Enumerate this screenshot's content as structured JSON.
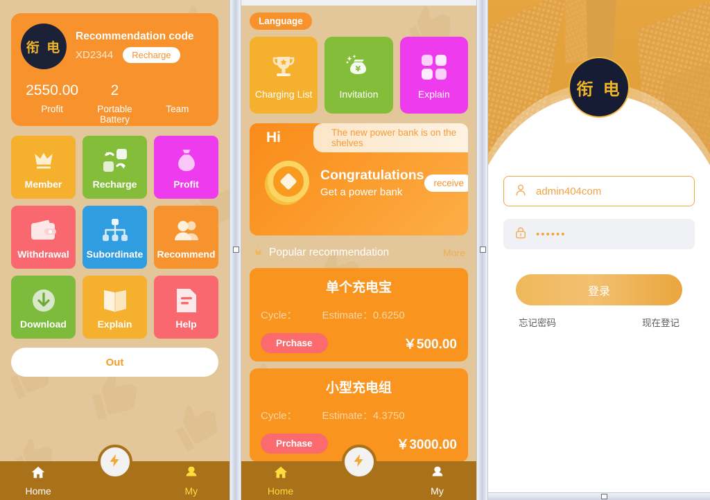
{
  "panel1": {
    "profile": {
      "logo_text": "衔 电",
      "title": "Recommendation code",
      "code": "XD2344",
      "recharge_label": "Recharge",
      "stats": [
        {
          "value": "2550.00",
          "label": "Profit"
        },
        {
          "value": "2",
          "label": "Portable Battery"
        },
        {
          "value": "",
          "label": "Team"
        }
      ]
    },
    "tiles": [
      {
        "label": "Member",
        "icon": "crown-icon",
        "bg": "#f5b02e"
      },
      {
        "label": "Recharge",
        "icon": "exchange-icon",
        "bg": "#84bd3a"
      },
      {
        "label": "Profit",
        "icon": "money-bag-icon",
        "bg": "#ee3bee"
      },
      {
        "label": "Withdrawal",
        "icon": "wallet-icon",
        "bg": "#f9686e"
      },
      {
        "label": "Subordinate",
        "icon": "hierarchy-icon",
        "bg": "#309de0"
      },
      {
        "label": "Recommend",
        "icon": "users-icon",
        "bg": "#f7932e"
      },
      {
        "label": "Download",
        "icon": "download-icon",
        "bg": "#7dbb3c"
      },
      {
        "label": "Explain",
        "icon": "book-icon",
        "bg": "#f5b02e"
      },
      {
        "label": "Help",
        "icon": "document-icon",
        "bg": "#f9686e"
      }
    ],
    "out_label": "Out",
    "tabbar": {
      "home_label": "Home",
      "my_label": "My",
      "active": "my",
      "fab_icon": "bolt-icon"
    }
  },
  "panel2": {
    "language_label": "Language",
    "quick_tiles": [
      {
        "label": "Charging List",
        "icon": "trophy-icon",
        "bg": "#f5b02e"
      },
      {
        "label": "Invitation",
        "icon": "money-bag-icon",
        "bg": "#84bd3a"
      },
      {
        "label": "Explain",
        "icon": "grid-apps-icon",
        "bg": "#ee3bee"
      }
    ],
    "promo": {
      "hi": "Hi",
      "ticker": "The new power bank is on the shelves",
      "title": "Congratulations",
      "subtitle": "Get a power bank",
      "receive_label": "receive",
      "coin_icon": "gold-coin-icon"
    },
    "section": {
      "flame_icon": "flame-icon",
      "title": "Popular recommendation",
      "more_label": "More"
    },
    "products": [
      {
        "name": "单个充电宝",
        "cycle_label": "Cycle：",
        "estimate_label": "Estimate：0.6250",
        "buy_label": "Prchase",
        "price": "￥500.00"
      },
      {
        "name": "小型充电组",
        "cycle_label": "Cycle：",
        "estimate_label": "Estimate：4.3750",
        "buy_label": "Prchase",
        "price": "￥3000.00"
      }
    ],
    "tabbar": {
      "home_label": "Home",
      "my_label": "My",
      "active": "home",
      "fab_icon": "bolt-icon"
    }
  },
  "panel3": {
    "logo_text": "衔 电",
    "username": {
      "value": "admin404com",
      "icon": "user-icon"
    },
    "password": {
      "value": "••••••",
      "icon": "lock-icon"
    },
    "login_label": "登录",
    "forgot_label": "忘记密码",
    "register_label": "现在登记"
  },
  "colors": {
    "brand_orange": "#f7922c",
    "page_bg": "#e3c79a",
    "tabbar": "#a9711a",
    "accent_yellow": "#ffdd3c",
    "gold": "#f0b429"
  }
}
